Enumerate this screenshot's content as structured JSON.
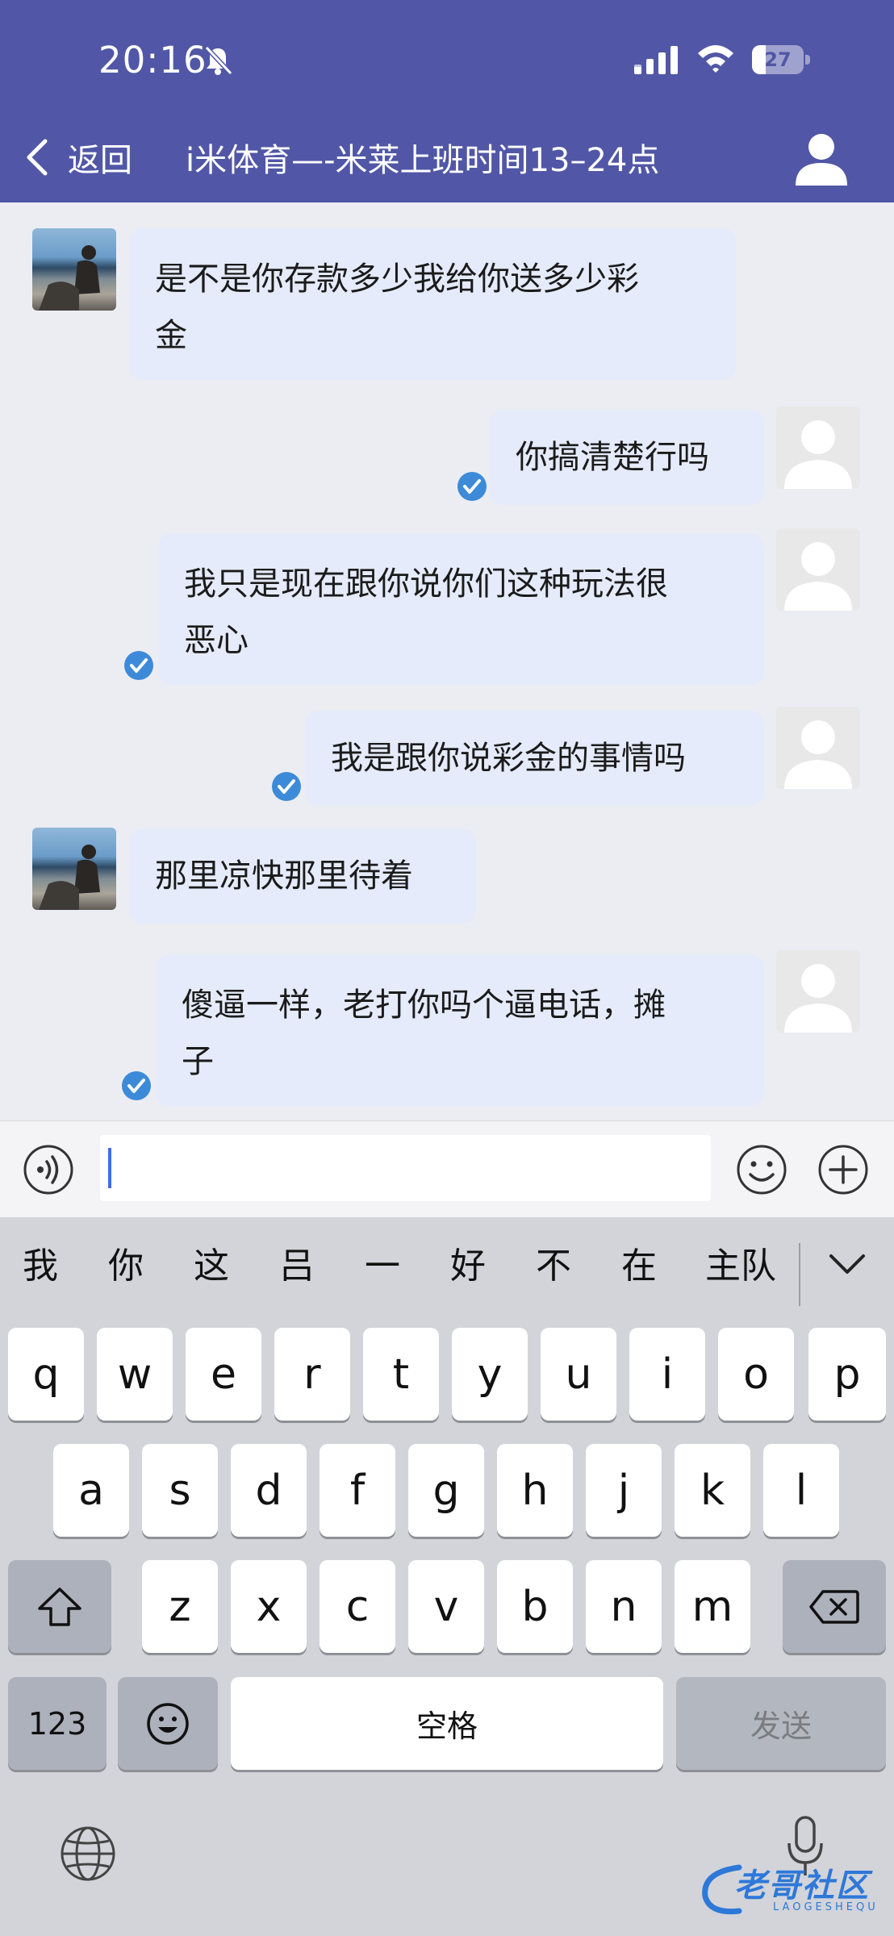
{
  "status_bar": {
    "time": "20:16",
    "battery_level": "27",
    "battery_fraction": 0.27,
    "icons": [
      "bell-slash-icon",
      "signal-icon",
      "wifi-icon",
      "battery-icon"
    ]
  },
  "header": {
    "back_label": "返回",
    "title": "i米体育—-米莱上班时间13–24点",
    "colors": {
      "background": "#5157a6",
      "text": "#ffffff"
    }
  },
  "messages": [
    {
      "side": "left",
      "text": "是不是你存款多少我给你送多少彩金",
      "lines": [
        "是不是你存款多少我给你送多少彩",
        "金"
      ],
      "avatar": "photo",
      "read_check": false
    },
    {
      "side": "right",
      "text": "你搞清楚行吗",
      "lines": [
        "你搞清楚行吗"
      ],
      "avatar": "default",
      "read_check": true
    },
    {
      "side": "right",
      "text": "我只是现在跟你说你们这种玩法很恶心",
      "lines": [
        "我只是现在跟你说你们这种玩法很",
        "恶心"
      ],
      "avatar": "default",
      "read_check": true
    },
    {
      "side": "right",
      "text": "我是跟你说彩金的事情吗",
      "lines": [
        "我是跟你说彩金的事情吗"
      ],
      "avatar": "default",
      "read_check": true
    },
    {
      "side": "left",
      "text": "那里凉快那里待着",
      "lines": [
        "那里凉快那里待着"
      ],
      "avatar": "photo",
      "read_check": false
    },
    {
      "side": "right",
      "text": "傻逼一样，老打你吗个逼电话，摊子",
      "lines": [
        "傻逼一样，老打你吗个逼电话，摊",
        "子"
      ],
      "avatar": "default",
      "read_check": true
    }
  ],
  "input_bar": {
    "value": "",
    "icons": [
      "voice-icon",
      "emoji-icon",
      "plus-icon"
    ]
  },
  "keyboard": {
    "candidates": [
      "我",
      "你",
      "这",
      "吕",
      "一",
      "好",
      "不",
      "在",
      "主队"
    ],
    "row1": [
      "q",
      "w",
      "e",
      "r",
      "t",
      "y",
      "u",
      "i",
      "o",
      "p"
    ],
    "row2": [
      "a",
      "s",
      "d",
      "f",
      "g",
      "h",
      "j",
      "k",
      "l"
    ],
    "row3": [
      "z",
      "x",
      "c",
      "v",
      "b",
      "n",
      "m"
    ],
    "numbers_label": "123",
    "space_label": "空格",
    "send_label": "发送"
  },
  "watermark": {
    "text": "老哥社区",
    "subtext": "LAOGESHEQU"
  },
  "colors": {
    "accent": "#5157a6",
    "bubble": "#e5ebfa",
    "check": "#3d8bd8",
    "page_bg": "#ecedf3",
    "keyboard_bg": "#d2d4da"
  }
}
